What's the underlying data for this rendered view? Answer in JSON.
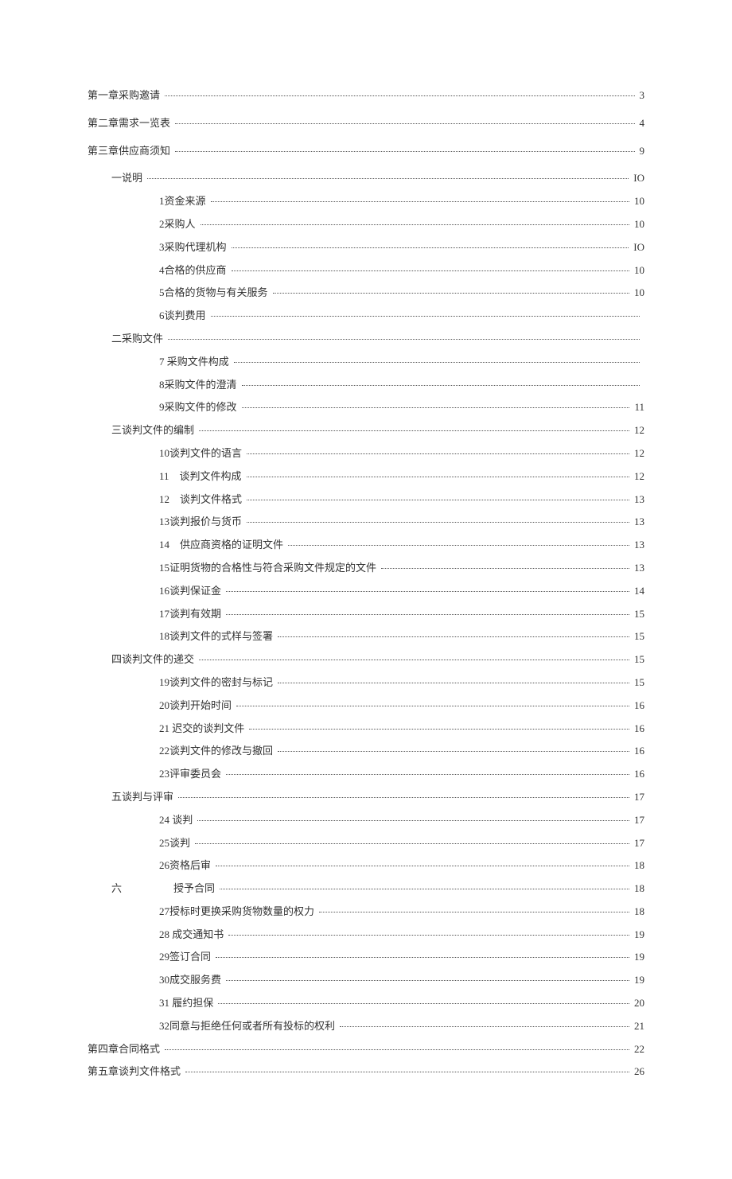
{
  "toc": [
    {
      "level": 0,
      "title": "第一章采购邀请",
      "page": "3"
    },
    {
      "level": 0,
      "title": "第二章需求一览表",
      "page": "4"
    },
    {
      "level": 0,
      "title": "第三章供应商须知",
      "page": "9"
    },
    {
      "level": 1,
      "title": "一说明",
      "page": "IO"
    },
    {
      "level": 2,
      "title": "1资金来源",
      "page": "10"
    },
    {
      "level": 2,
      "title": "2采购人",
      "page": "10"
    },
    {
      "level": 2,
      "title": "3采购代理机构",
      "page": "IO"
    },
    {
      "level": 2,
      "title": "4合格的供应商",
      "page": "10"
    },
    {
      "level": 2,
      "title": "5合格的货物与有关服务",
      "page": "10"
    },
    {
      "level": 2,
      "title": "6谈判费用",
      "page": ""
    },
    {
      "level": 1,
      "title": "二采购文件",
      "page": ""
    },
    {
      "level": 2,
      "title": "7 采购文件构成",
      "page": ""
    },
    {
      "level": 2,
      "title": "8采购文件的澄清",
      "page": ""
    },
    {
      "level": 2,
      "title": "9采购文件的修改",
      "page": "11"
    },
    {
      "level": 1,
      "title": "三谈判文件的编制",
      "page": "12"
    },
    {
      "level": 2,
      "title": "10谈判文件的语言",
      "page": "12"
    },
    {
      "level": 2,
      "title": "11　谈判文件构成",
      "page": "12"
    },
    {
      "level": 2,
      "title": "12　谈判文件格式",
      "page": "13"
    },
    {
      "level": 2,
      "title": "13谈判报价与货币",
      "page": "13"
    },
    {
      "level": 2,
      "title": "14　供应商资格的证明文件",
      "page": "13"
    },
    {
      "level": 2,
      "title": "15证明货物的合格性与符合采购文件规定的文件",
      "page": "13"
    },
    {
      "level": 2,
      "title": "16谈判保证金",
      "page": "14"
    },
    {
      "level": 2,
      "title": "17谈判有效期",
      "page": "15"
    },
    {
      "level": 2,
      "title": "18谈判文件的式样与签署",
      "page": "15"
    },
    {
      "level": 1,
      "title": "四谈判文件的递交",
      "page": "15"
    },
    {
      "level": 2,
      "title": "19谈判文件的密封与标记",
      "page": "15"
    },
    {
      "level": 2,
      "title": "20谈判开始时间",
      "page": "16"
    },
    {
      "level": 2,
      "title": "21 迟交的谈判文件",
      "page": "16"
    },
    {
      "level": 2,
      "title": "22谈判文件的修改与撤回",
      "page": "16"
    },
    {
      "level": 2,
      "title": "23评审委员会",
      "page": "16"
    },
    {
      "level": 1,
      "title": "五谈判与评审",
      "page": "17"
    },
    {
      "level": 2,
      "title": "24 谈判",
      "page": "17"
    },
    {
      "level": 2,
      "title": "25谈判",
      "page": "17"
    },
    {
      "level": 2,
      "title": "26资格后审",
      "page": "18"
    },
    {
      "level": 1,
      "title": "六　　　　　授予合同",
      "page": "18"
    },
    {
      "level": 2,
      "title": "27授标时更换采购货物数量的权力",
      "page": "18"
    },
    {
      "level": 2,
      "title": "28 成交通知书",
      "page": "19"
    },
    {
      "level": 2,
      "title": "29签订合同",
      "page": "19"
    },
    {
      "level": 2,
      "title": "30成交服务费",
      "page": "19"
    },
    {
      "level": 2,
      "title": "31 履约担保",
      "page": "20"
    },
    {
      "level": 2,
      "title": "32同意与拒绝任何或者所有投标的权利",
      "page": "21"
    },
    {
      "level": 0,
      "title": "第四章合同格式",
      "page": "22",
      "tight": true
    },
    {
      "level": 0,
      "title": "第五章谈判文件格式",
      "page": "26"
    }
  ]
}
